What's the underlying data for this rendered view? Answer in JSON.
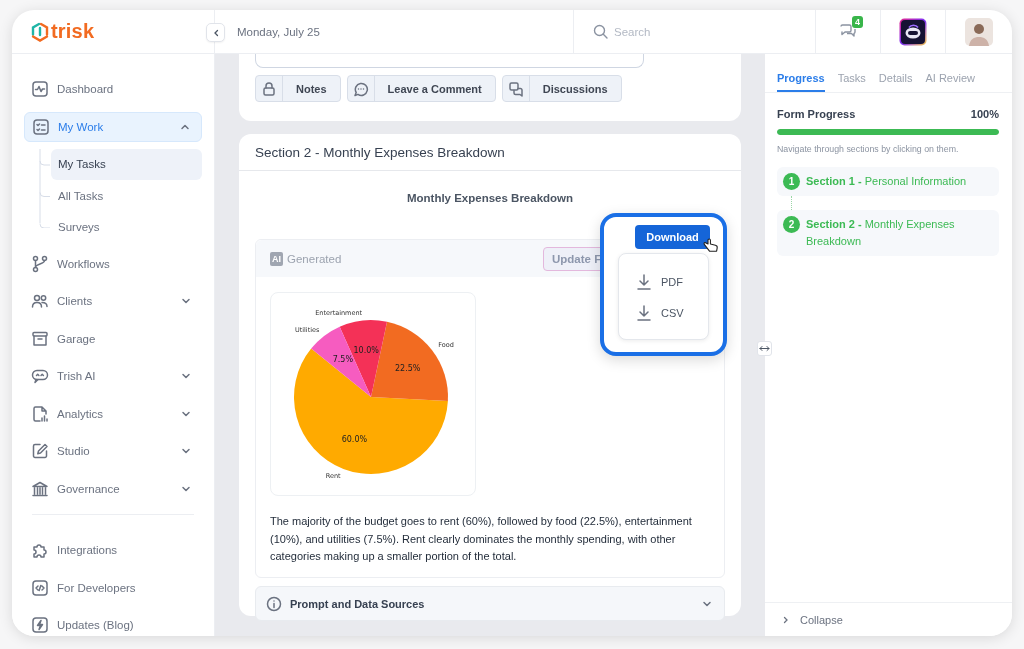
{
  "logo": {
    "text": "trisk"
  },
  "header": {
    "date": "Monday, July 25",
    "search": {
      "placeholder": "Search"
    },
    "notifications": {
      "count": "4"
    }
  },
  "sidebar": {
    "items": [
      {
        "kind": "link",
        "label": "Dashboard",
        "selected": false
      },
      {
        "kind": "group",
        "label": "My Work",
        "selected": true,
        "expanded": true,
        "children": [
          {
            "label": "My Tasks",
            "selected": true
          },
          {
            "label": "All Tasks",
            "selected": false
          },
          {
            "label": "Surveys",
            "selected": false
          }
        ]
      },
      {
        "kind": "link",
        "label": "Workflows",
        "selected": false
      },
      {
        "kind": "group",
        "label": "Clients",
        "selected": false,
        "expanded": false
      },
      {
        "kind": "link",
        "label": "Garage",
        "selected": false
      },
      {
        "kind": "group",
        "label": "Trish AI",
        "selected": false,
        "expanded": false
      },
      {
        "kind": "group",
        "label": "Analytics",
        "selected": false,
        "expanded": false
      },
      {
        "kind": "group",
        "label": "Studio",
        "selected": false,
        "expanded": false
      },
      {
        "kind": "group",
        "label": "Governance",
        "selected": false,
        "expanded": false
      }
    ],
    "bottom_items": [
      {
        "label": "Integrations",
        "selected": false
      },
      {
        "label": "For Developers",
        "selected": false
      },
      {
        "label": "Updates (Blog)",
        "selected": false
      }
    ]
  },
  "main": {
    "actions": [
      {
        "label": "Notes"
      },
      {
        "label": "Leave a Comment"
      },
      {
        "label": "Discussions"
      }
    ],
    "section": {
      "title": "Section 2 - Monthly Expenses Breakdown",
      "chart_title": "Monthly Expenses Breakdown",
      "ai_badge": "AI",
      "ai_label": "Generated",
      "update_button": "Update F",
      "download_button": "Download",
      "download_menu": [
        {
          "label": "PDF"
        },
        {
          "label": "CSV"
        }
      ],
      "chart_data": {
        "type": "pie",
        "categories": [
          "Rent",
          "Food",
          "Entertainment",
          "Utilities"
        ],
        "values": [
          60,
          22.5,
          10,
          7.5
        ],
        "value_labels": [
          "60.0%",
          "22.5%",
          "10.0%",
          "7.5%"
        ]
      },
      "summary": "The majority of the budget goes to rent (60%), followed by food (22.5%), entertainment (10%), and utilities (7.5%). Rent clearly dominates the monthly spending, with other categories making up a smaller portion of the total.",
      "prompt_toggle": {
        "label": "Prompt and Data Sources",
        "expanded": false
      }
    }
  },
  "right_panel": {
    "tabs": [
      {
        "label": "Progress",
        "selected": true
      },
      {
        "label": "Tasks",
        "selected": false
      },
      {
        "label": "Details",
        "selected": false
      },
      {
        "label": "AI Review",
        "selected": false
      }
    ],
    "progress": {
      "label": "Form Progress",
      "reading": "100%",
      "level": 1,
      "hint": "Navigate through sections by clicking on them."
    },
    "sections": [
      {
        "number": "1",
        "title": "**Section 1 -** Personal Information"
      },
      {
        "number": "2",
        "title": "**Section 2 -** Monthly Expenses Breakdown"
      }
    ],
    "collapse": "Collapse"
  }
}
